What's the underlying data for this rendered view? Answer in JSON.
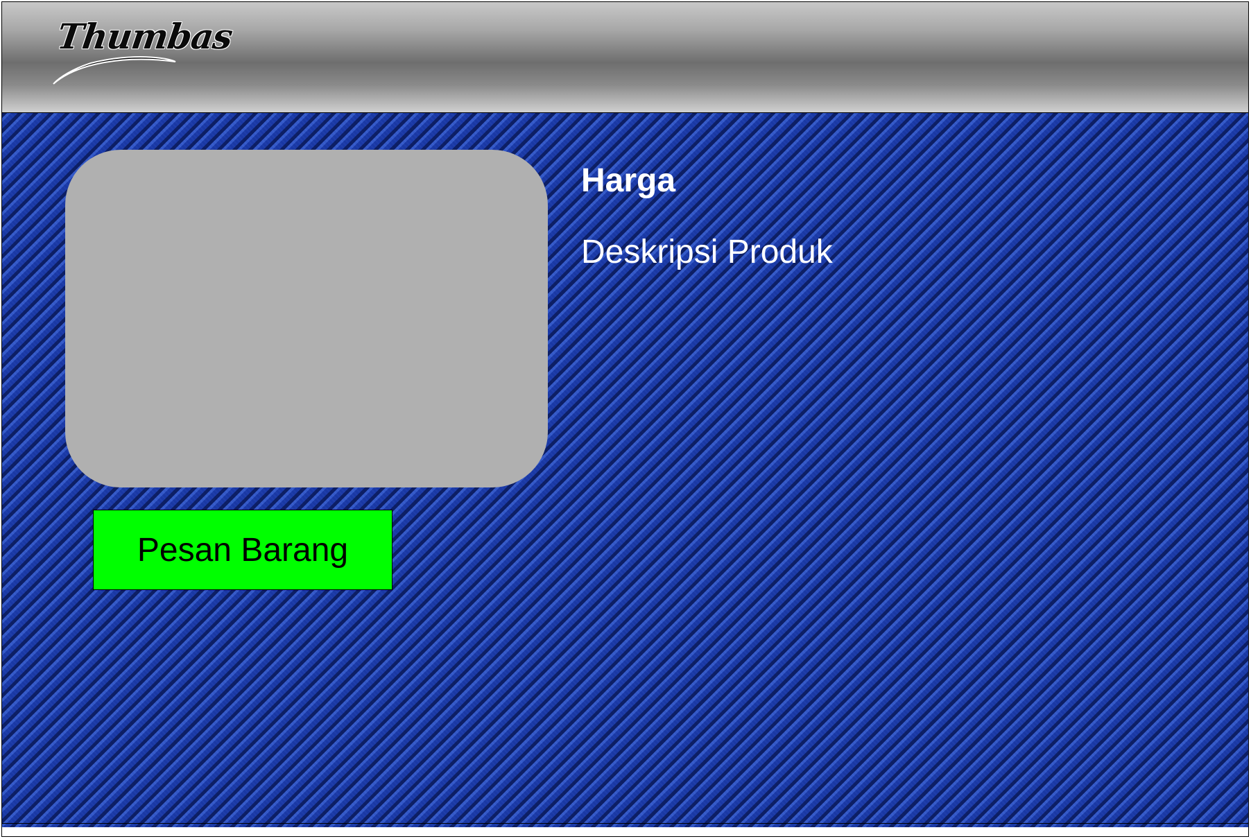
{
  "header": {
    "logo_text": "Thumbas"
  },
  "product": {
    "price_label": "Harga",
    "description_label": "Deskripsi Produk",
    "image_placeholder_color": "#b0b0b0"
  },
  "actions": {
    "order_button_label": "Pesan Barang",
    "order_button_color": "#00ff00"
  },
  "theme": {
    "background_color": "#1b3ea6",
    "header_color": "#8a8a8a"
  }
}
